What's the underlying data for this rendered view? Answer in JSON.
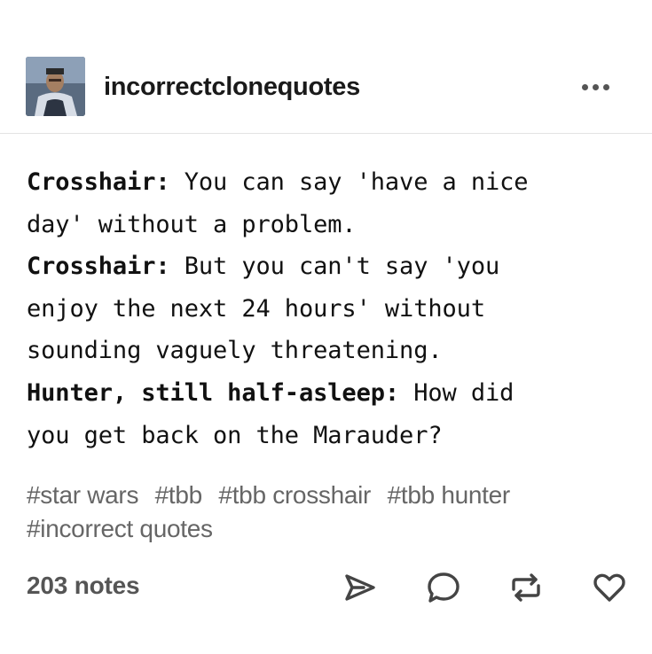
{
  "post": {
    "blog_name": "incorrectclonequotes",
    "lines": [
      {
        "speaker": "Crosshair:",
        "text": " You can say 'have a nice",
        "cont": "day' without a problem."
      },
      {
        "speaker": "Crosshair:",
        "text": " But you can't say 'you",
        "cont": "enjoy the next 24 hours' without",
        "cont2": "sounding vaguely threatening."
      },
      {
        "speaker": "Hunter, still half-asleep:",
        "text": " How did",
        "cont": "you get back on the Marauder?"
      }
    ],
    "tags": [
      "#star wars",
      "#tbb",
      "#tbb crosshair",
      "#tbb hunter",
      "#incorrect quotes"
    ],
    "notes": "203 notes"
  },
  "icons": {
    "avatar": "avatar-image",
    "menu": "more-options-icon",
    "share": "share-icon",
    "reply": "reply-icon",
    "reblog": "reblog-icon",
    "like": "heart-icon"
  }
}
